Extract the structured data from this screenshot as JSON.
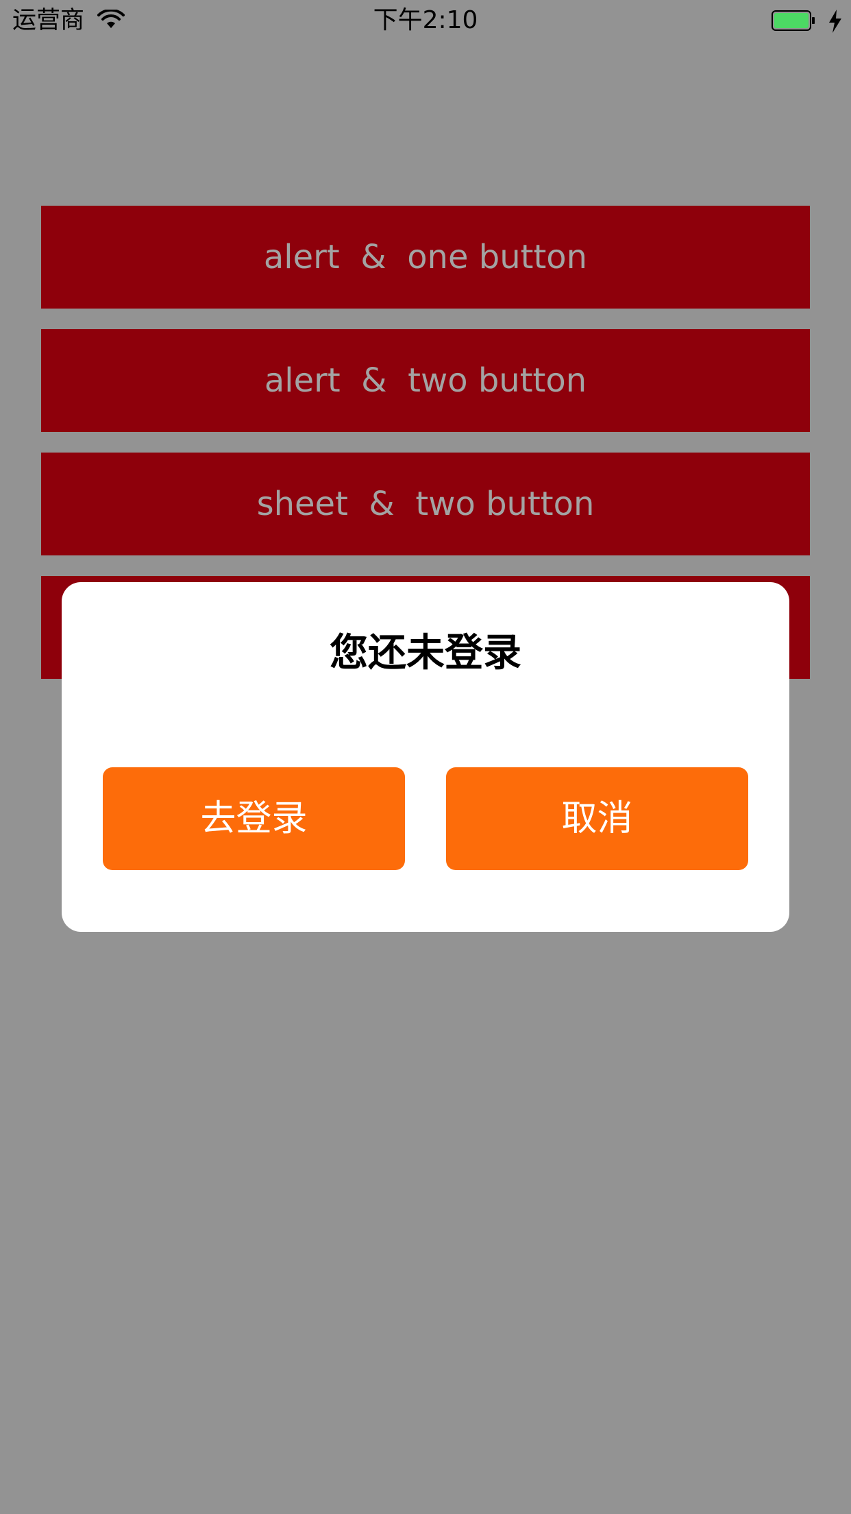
{
  "status_bar": {
    "carrier": "运营商",
    "time": "下午2:10",
    "battery_color": "#4cd964"
  },
  "menu": {
    "items": [
      {
        "label": "alert  &  one button"
      },
      {
        "label": "alert  &  two button"
      },
      {
        "label": "sheet  &  two button"
      },
      {
        "label": ""
      }
    ],
    "button_bg": "#8e000b",
    "button_text_color": "#a3a3a3"
  },
  "dialog": {
    "title": "您还未登录",
    "confirm_label": "去登录",
    "cancel_label": "取消",
    "button_color": "#fd6c0a"
  },
  "overlay_color": "#939393"
}
